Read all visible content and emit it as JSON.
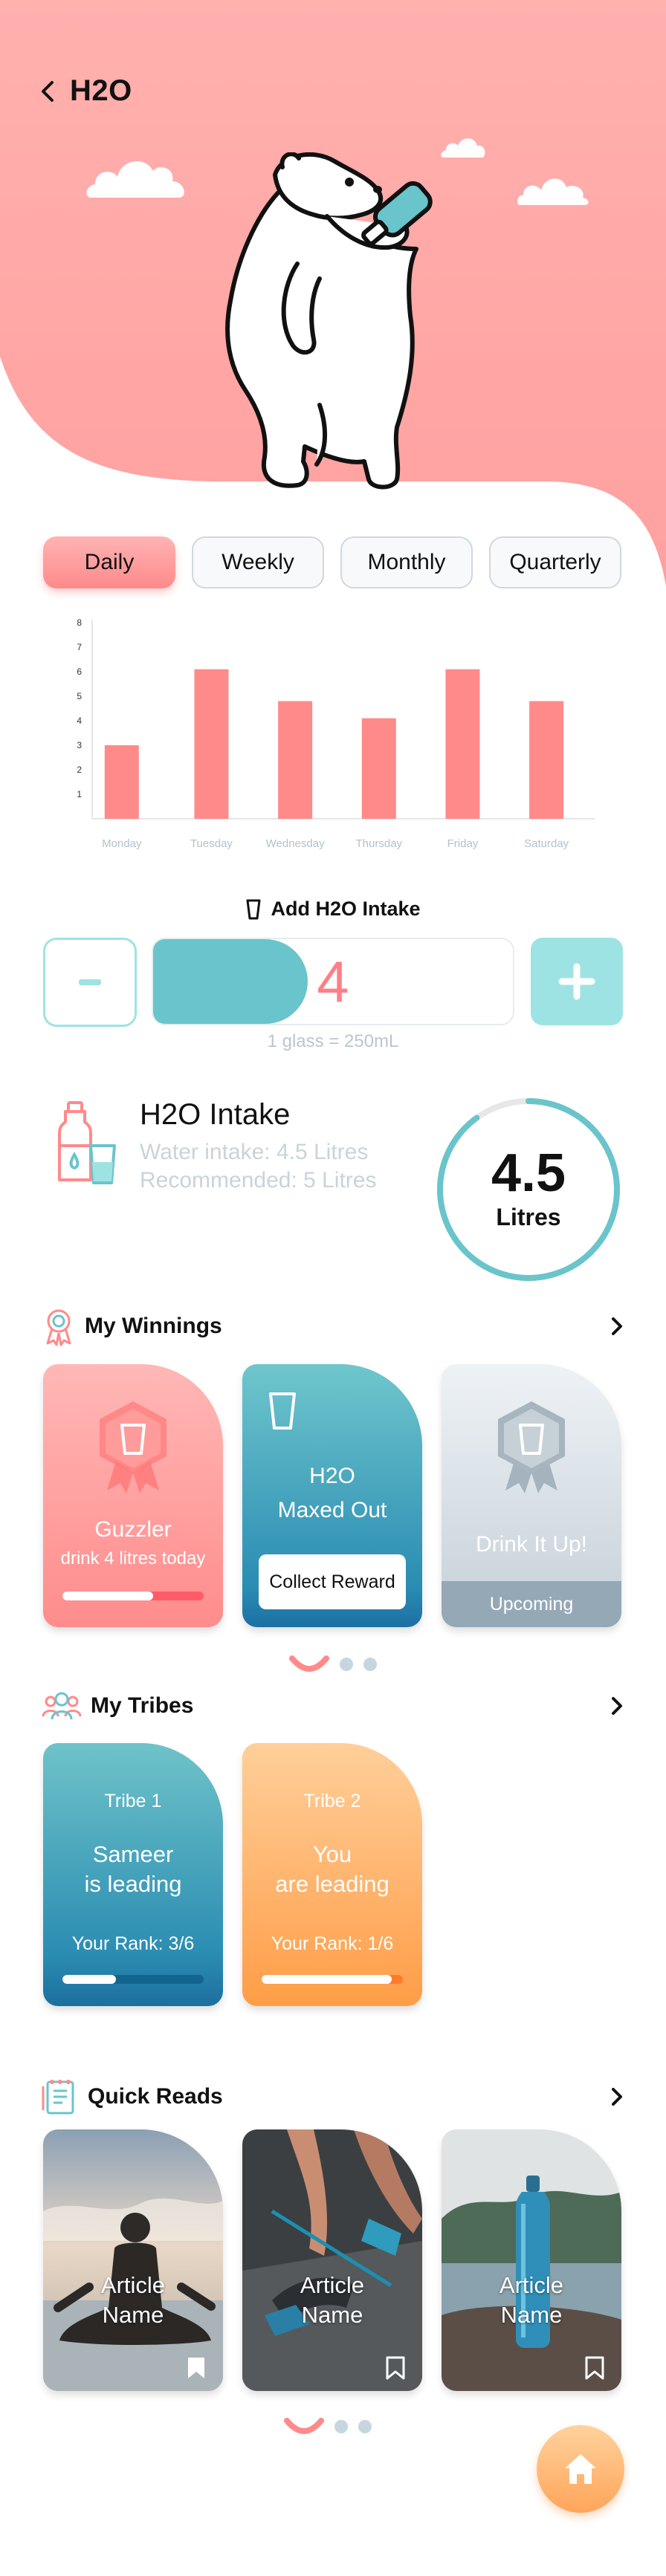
{
  "header": {
    "title": "H2O"
  },
  "tabs": [
    {
      "label": "Daily",
      "active": true
    },
    {
      "label": "Weekly",
      "active": false
    },
    {
      "label": "Monthly",
      "active": false
    },
    {
      "label": "Quarterly",
      "active": false
    }
  ],
  "chart_data": {
    "type": "bar",
    "categories": [
      "Monday",
      "Tuesday",
      "Wednesday",
      "Thursday",
      "Friday",
      "Saturday"
    ],
    "values": [
      3,
      6.1,
      4.8,
      4.1,
      6.1,
      4.8
    ],
    "ylim": [
      0,
      8
    ],
    "yticks": [
      1,
      2,
      3,
      4,
      5,
      6,
      7,
      8
    ],
    "bar_color": "#ff8a8a",
    "title": "",
    "xlabel": "",
    "ylabel": ""
  },
  "intake_control": {
    "title": "Add H2O Intake",
    "value": "4",
    "fill_fraction": 0.43,
    "note": "1 glass = 250mL"
  },
  "summary": {
    "title": "H2O Intake",
    "water_intake": "Water intake: 4.5 Litres",
    "recommended": "Recommended: 5 Litres",
    "ring_value": "4.5",
    "ring_unit": "Litres",
    "ring_fraction": 0.9
  },
  "winnings": {
    "title": "My Winnings",
    "cards": [
      {
        "name": "Guzzler",
        "desc": "drink 4 litres today",
        "progress": 0.64
      },
      {
        "line1": "H2O",
        "line2": "Maxed Out",
        "button": "Collect Reward"
      },
      {
        "name": "Drink It Up!",
        "status": "Upcoming"
      }
    ]
  },
  "tribes": {
    "title": "My Tribes",
    "cards": [
      {
        "tribe": "Tribe 1",
        "line1": "Sameer",
        "line2": "is leading",
        "rank": "Your Rank: 3/6",
        "progress": 0.38
      },
      {
        "tribe": "Tribe 2",
        "line1": "You",
        "line2": "are leading",
        "rank": "Your Rank: 1/6",
        "progress": 0.92
      }
    ]
  },
  "quick_reads": {
    "title": "Quick Reads",
    "cards": [
      {
        "line1": "Article",
        "line2": "Name"
      },
      {
        "line1": "Article",
        "line2": "Name"
      },
      {
        "line1": "Article",
        "line2": "Name"
      }
    ]
  },
  "colors": {
    "coral": "#ff8a8a",
    "teal": "#6ac4cb",
    "aqua": "#9ee3e3",
    "orange": "#ffa55a"
  },
  "icons": [
    "chevron-left-icon",
    "cloud-icon",
    "bear-illustration",
    "cup-icon",
    "bottle-glass-icon",
    "award-icon",
    "group-icon",
    "notes-icon",
    "chevron-right-icon",
    "bookmark-icon",
    "home-icon"
  ]
}
